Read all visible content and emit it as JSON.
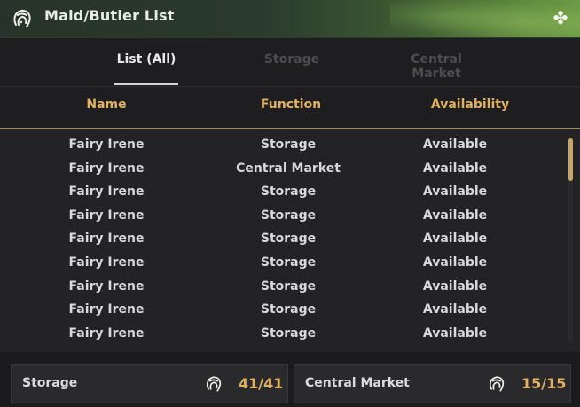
{
  "window": {
    "title": "Maid/Butler List",
    "title_icon": "maid-icon",
    "corner_icon": "clover-icon"
  },
  "tabs": [
    {
      "label": "List (All)",
      "active": true
    },
    {
      "label": "Storage",
      "active": false
    },
    {
      "label": "Central Market",
      "active": false
    }
  ],
  "table": {
    "headers": [
      "Name",
      "Function",
      "Availability"
    ],
    "rows": [
      {
        "name": "Fairy Irene",
        "function": "Storage",
        "availability": "Available"
      },
      {
        "name": "Fairy Irene",
        "function": "Central Market",
        "availability": "Available"
      },
      {
        "name": "Fairy Irene",
        "function": "Storage",
        "availability": "Available"
      },
      {
        "name": "Fairy Irene",
        "function": "Storage",
        "availability": "Available"
      },
      {
        "name": "Fairy Irene",
        "function": "Storage",
        "availability": "Available"
      },
      {
        "name": "Fairy Irene",
        "function": "Storage",
        "availability": "Available"
      },
      {
        "name": "Fairy Irene",
        "function": "Storage",
        "availability": "Available"
      },
      {
        "name": "Fairy Irene",
        "function": "Storage",
        "availability": "Available"
      },
      {
        "name": "Fairy Irene",
        "function": "Storage",
        "availability": "Available"
      }
    ]
  },
  "footer": {
    "storage": {
      "label": "Storage",
      "count": "41/41",
      "icon": "maid-icon"
    },
    "market": {
      "label": "Central Market",
      "count": "15/15",
      "icon": "maid-icon"
    }
  },
  "colors": {
    "accent_gold": "#e3b260",
    "header_green": "#5f8a3e",
    "active_tab": "#e8e8ea",
    "inactive_tab": "#4d4d52"
  }
}
